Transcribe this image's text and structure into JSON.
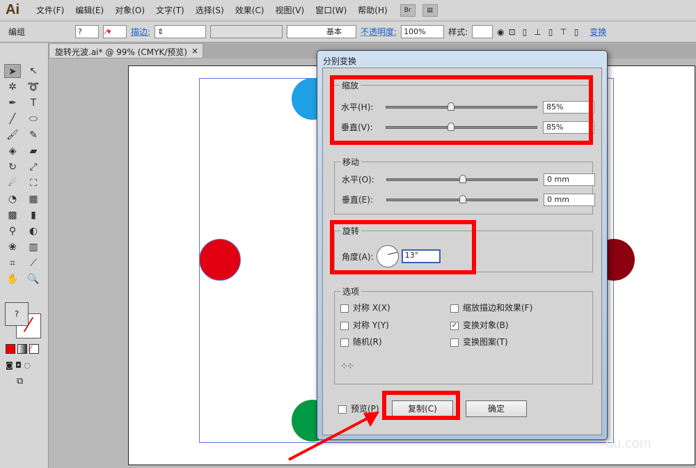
{
  "app": {
    "logo": "Ai",
    "menus": [
      "文件(F)",
      "编辑(E)",
      "对象(O)",
      "文字(T)",
      "选择(S)",
      "效果(C)",
      "视图(V)",
      "窗口(W)",
      "帮助(H)"
    ],
    "bridge": "Br"
  },
  "control": {
    "selection": "编组",
    "fill": "?",
    "stroke_label": "描边:",
    "brush": "基本",
    "opacity_label": "不透明度:",
    "opacity": "100%",
    "style_label": "样式:",
    "transform": "变换"
  },
  "document": {
    "tab": "旋转光波.ai* @ 99% (CMYK/预览)",
    "close": "×"
  },
  "colors": {
    "blue": "#1ea0e6",
    "red": "#e00012",
    "green": "#009944",
    "darkred": "#8a0010"
  },
  "dialog": {
    "title": "分别变换",
    "scale": {
      "label": "缩放",
      "h_label": "水平(H):",
      "h_value": "85%",
      "h_fraction": 0.425,
      "v_label": "垂直(V):",
      "v_value": "85%",
      "v_fraction": 0.425
    },
    "move": {
      "label": "移动",
      "h_label": "水平(O):",
      "h_value": "0 mm",
      "v_label": "垂直(E):",
      "v_value": "0 mm"
    },
    "rotate": {
      "label": "旋转",
      "angle_label": "角度(A):",
      "angle": "13°"
    },
    "options": {
      "label": "选项",
      "items": [
        {
          "label": "对称 X(X)",
          "checked": false
        },
        {
          "label": "缩放描边和效果(F)",
          "checked": false
        },
        {
          "label": "对称 Y(Y)",
          "checked": false
        },
        {
          "label": "变换对象(B)",
          "checked": true
        },
        {
          "label": "随机(R)",
          "checked": false
        },
        {
          "label": "变换图案(T)",
          "checked": false
        }
      ]
    },
    "preview": "预览(P)",
    "copy": "复制(C)",
    "ok": "确定"
  },
  "watermark": "du.com"
}
